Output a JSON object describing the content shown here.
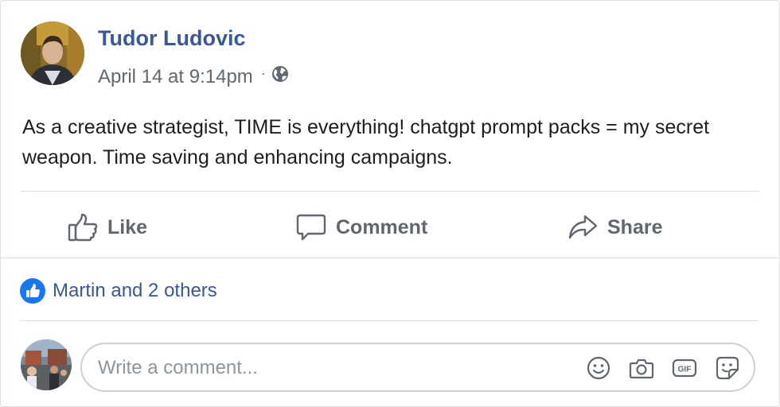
{
  "post": {
    "author": "Tudor Ludovic",
    "timestamp": "April 14 at 9:14pm",
    "separator": "·",
    "privacy_icon": "globe-icon",
    "text": "As a creative strategist, TIME is everything! chatgpt prompt packs = my secret weapon. Time saving and enhancing campaigns."
  },
  "actions": {
    "like_label": "Like",
    "comment_label": "Comment",
    "share_label": "Share"
  },
  "reactions": {
    "summary": "Martin and 2 others",
    "icon": "like-badge-icon"
  },
  "composer": {
    "placeholder": "Write a comment...",
    "icons": [
      "emoji-icon",
      "camera-icon",
      "gif-icon",
      "sticker-icon"
    ]
  },
  "colors": {
    "author_blue": "#385898",
    "text_gray": "#606770",
    "like_blue": "#1877f2",
    "divider": "#dadde1"
  }
}
